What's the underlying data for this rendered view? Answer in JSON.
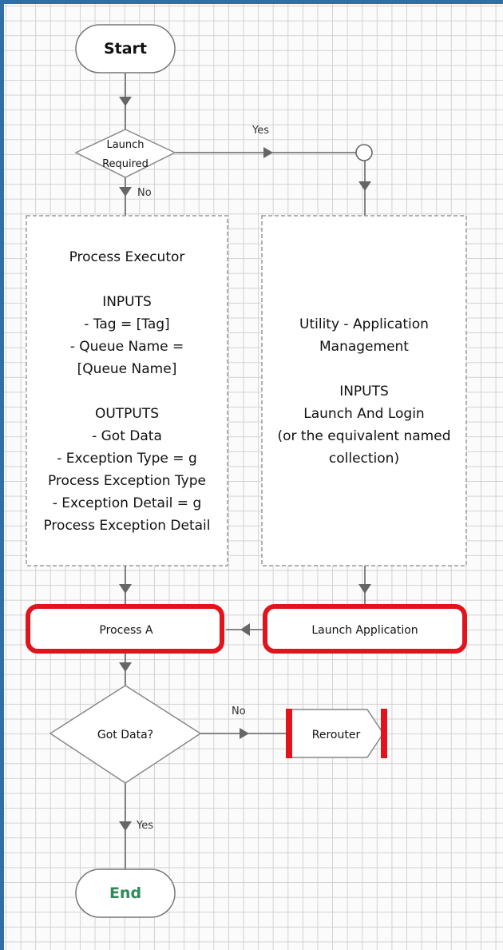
{
  "nodes": {
    "start": "Start",
    "launch_required": [
      "Launch",
      "Required"
    ],
    "process_executor": "Process Executor\n\nINPUTS\n- Tag   = [Tag]\n- Queue Name   =\n[Queue Name]\n\nOUTPUTS\n- Got Data\n- Exception Type   = g\nProcess Exception Type\n- Exception Detail   = g\nProcess Exception Detail",
    "utility_app_mgmt": "Utility - Application\nManagement\n\nINPUTS\nLaunch And Login\n(or the equivalent named\ncollection)",
    "process_a": "Process A",
    "launch_application": "Launch Application",
    "got_data": "Got Data?",
    "rerouter": "Rerouter",
    "end": "End"
  },
  "edges": {
    "launch_yes": "Yes",
    "launch_no": "No",
    "got_data_no": "No",
    "got_data_yes": "Yes"
  },
  "colors": {
    "grid": "#d2d2d2",
    "frame": "#2f6fa5",
    "highlight_red": "#e0141a",
    "end_text": "#2e8b57",
    "connector": "#666666"
  }
}
